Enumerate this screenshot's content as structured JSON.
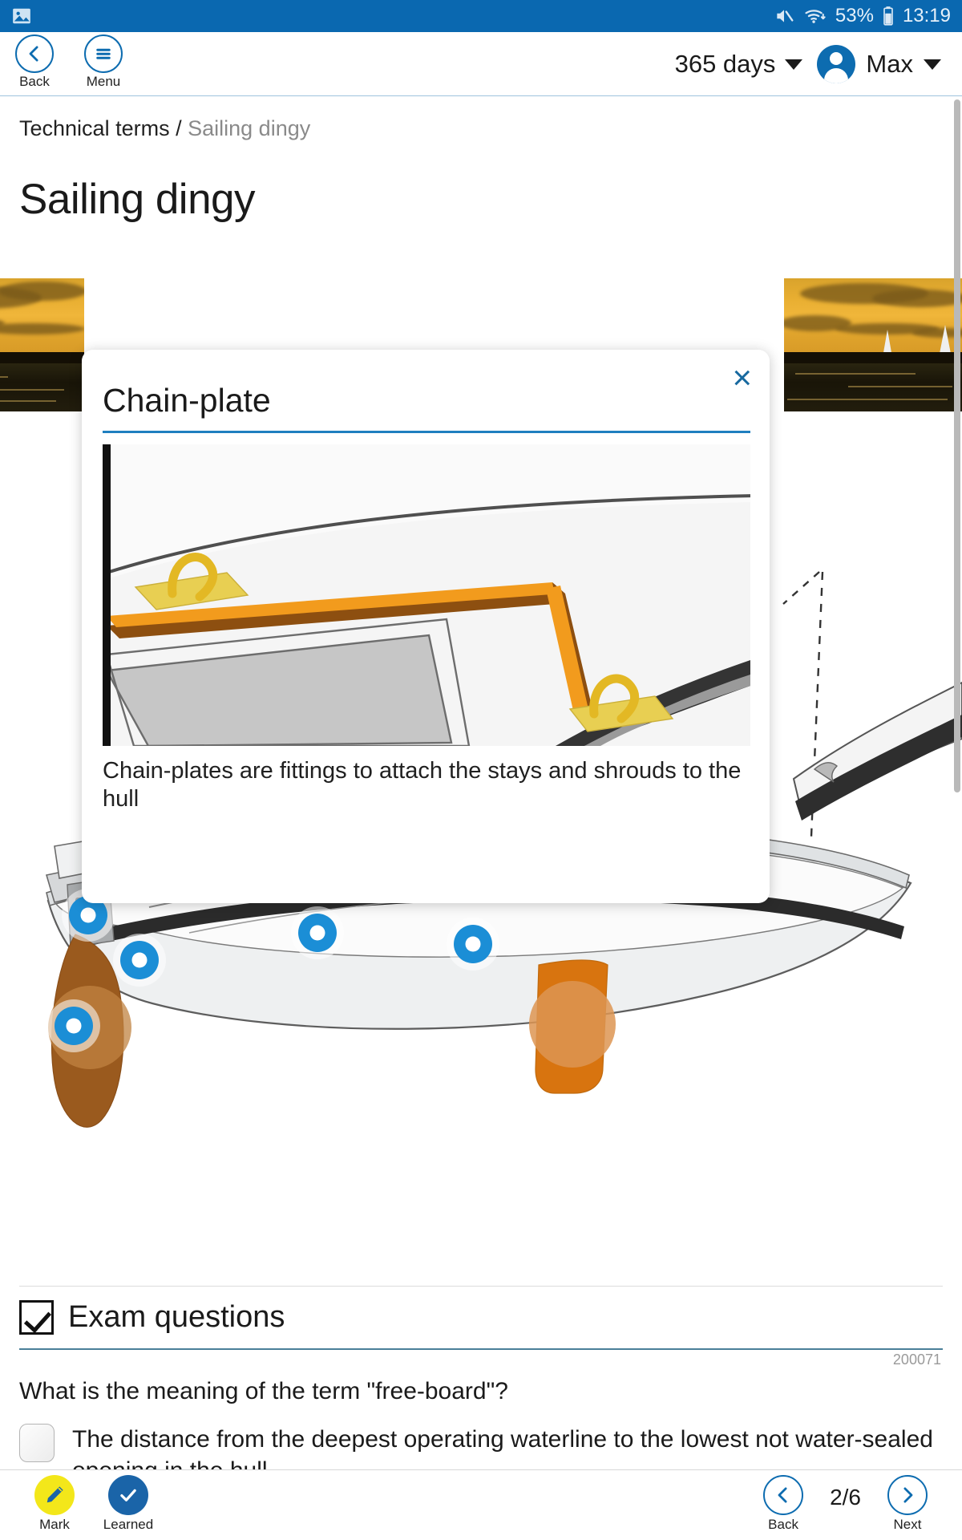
{
  "statusbar": {
    "image_icon": "gallery-icon",
    "mute_icon": "mute-icon",
    "wifi_icon": "wifi-icon",
    "battery_pct": "53%",
    "battery_icon": "battery-icon",
    "time": "13:19"
  },
  "header": {
    "back_label": "Back",
    "menu_label": "Menu",
    "days_label": "365 days",
    "user_name": "Max"
  },
  "breadcrumb": {
    "root": "Technical terms",
    "separator": "/",
    "current": "Sailing dingy"
  },
  "page": {
    "title": "Sailing dingy"
  },
  "popup": {
    "title": "Chain-plate",
    "close_label": "×",
    "caption": "Chain-plates are fittings to attach the stays and shrouds to the hull"
  },
  "exam": {
    "heading": "Exam questions",
    "question_id": "200071",
    "question": "What is the meaning of the term \"free-board\"?",
    "answers": [
      "The distance from the deepest operating waterline to the lowest not water-sealed opening in the hull"
    ]
  },
  "bottombar": {
    "mark_label": "Mark",
    "learned_label": "Learned",
    "back_label": "Back",
    "next_label": "Next",
    "page_indicator": "2/6"
  },
  "colors": {
    "brand_blue": "#0d6cb0",
    "status_blue": "#0a68b0",
    "accent_rule": "#1f7fbf",
    "hotspot": "#1b8ed6",
    "mark_yellow": "#f3e71a",
    "learned_blue": "#1a64a8",
    "muted_text": "#8a8a8a"
  }
}
